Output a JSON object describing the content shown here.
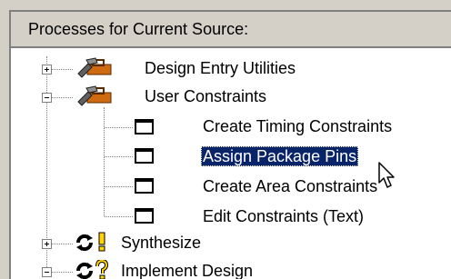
{
  "panel": {
    "header_title": "Processes for Current Source:"
  },
  "tree": {
    "items": [
      {
        "label": "Design Entry Utilities",
        "expander": "plus",
        "icon": "tools-icon"
      },
      {
        "label": "User Constraints",
        "expander": "minus",
        "icon": "tools-icon"
      },
      {
        "label": "Create Timing Constraints",
        "icon": "process-window-icon"
      },
      {
        "label": "Assign Package Pins",
        "icon": "process-window-icon",
        "selected": true
      },
      {
        "label": "Create Area Constraints",
        "icon": "process-window-icon"
      },
      {
        "label": "Edit Constraints (Text)",
        "icon": "process-window-icon"
      },
      {
        "label": "Synthesize",
        "expander": "plus",
        "icon": "run-cycle-icon",
        "status_icon": "warning-exclamation-icon"
      },
      {
        "label": "Implement Design",
        "expander": "minus",
        "icon": "run-cycle-icon",
        "status_icon": "status-question-icon"
      }
    ]
  },
  "colors": {
    "selection": "#0a246a",
    "panel_bg": "#ffffff",
    "chrome": "#d4d0c8",
    "warning": "#ffd400",
    "tools_orange": "#d06a10"
  }
}
